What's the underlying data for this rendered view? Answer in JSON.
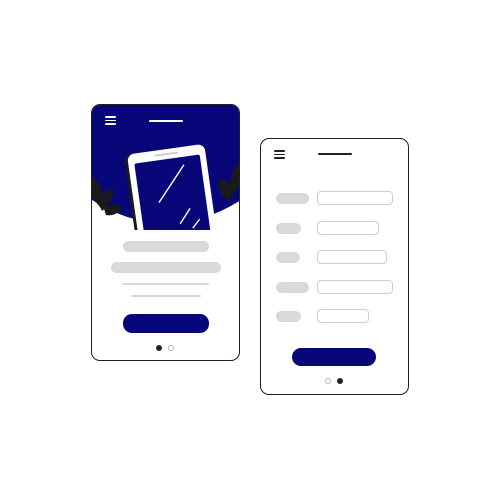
{
  "colors": {
    "accent": "#07077a",
    "placeholder_gray": "#d9d9d9",
    "outline": "#1f1f1f",
    "dot_active": "#222222",
    "dot_inactive": "#b5b5b5"
  },
  "left_screen": {
    "icons": [
      "menu-icon",
      "smartphone-illustration",
      "plant-leaves-icon"
    ],
    "pagination": {
      "pages": 2,
      "active": 1
    }
  },
  "right_screen": {
    "icons": [
      "menu-icon"
    ],
    "form_fields": [
      {
        "label": "",
        "value": ""
      },
      {
        "label": "",
        "value": ""
      },
      {
        "label": "",
        "value": ""
      },
      {
        "label": "",
        "value": ""
      },
      {
        "label": "",
        "value": ""
      }
    ],
    "pagination": {
      "pages": 2,
      "active": 2
    }
  }
}
